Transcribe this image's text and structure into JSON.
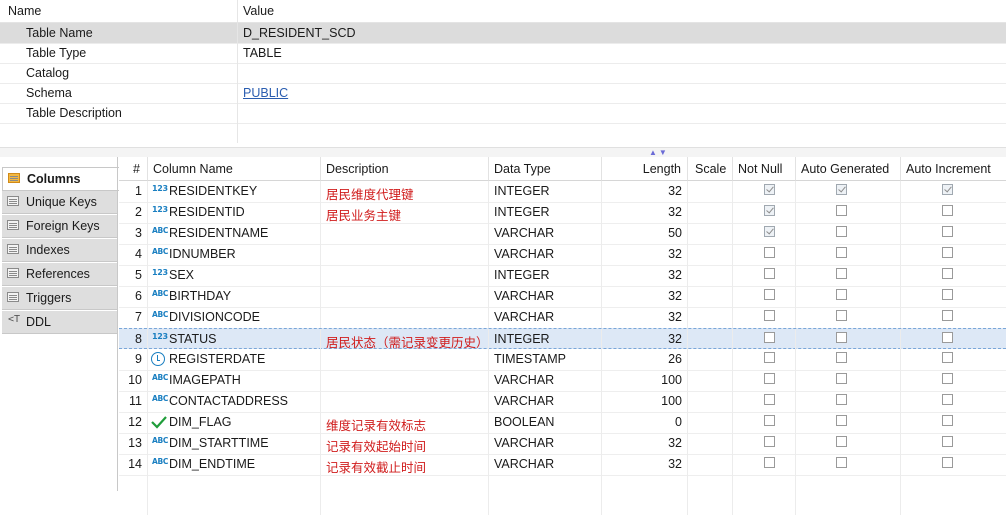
{
  "properties": {
    "header": {
      "name": "Name",
      "value": "Value"
    },
    "rows": [
      {
        "key": "Table Name",
        "value": "D_RESIDENT_SCD"
      },
      {
        "key": "Table Type",
        "value": "TABLE"
      },
      {
        "key": "Catalog",
        "value": ""
      },
      {
        "key": "Schema",
        "value": "PUBLIC"
      },
      {
        "key": "Table Description",
        "value": ""
      }
    ]
  },
  "tabs": [
    {
      "label": "Columns",
      "active": true
    },
    {
      "label": "Unique Keys"
    },
    {
      "label": "Foreign Keys"
    },
    {
      "label": "Indexes"
    },
    {
      "label": "References"
    },
    {
      "label": "Triggers"
    },
    {
      "label": "DDL"
    }
  ],
  "grid": {
    "headers": {
      "num": "#",
      "name": "Column Name",
      "desc": "Description",
      "type": "Data Type",
      "length": "Length",
      "scale": "Scale",
      "notnull": "Not Null",
      "autogen": "Auto Generated",
      "autoinc": "Auto Increment"
    },
    "rows": [
      {
        "n": "1",
        "icon": "123",
        "name": "RESIDENTKEY",
        "desc": "居民维度代理键",
        "type": "INTEGER",
        "length": "32",
        "nn": true,
        "ag": true,
        "ai": true
      },
      {
        "n": "2",
        "icon": "123",
        "name": "RESIDENTID",
        "desc": "居民业务主键",
        "type": "INTEGER",
        "length": "32",
        "nn": true,
        "ag": false,
        "ai": false
      },
      {
        "n": "3",
        "icon": "abc",
        "name": "RESIDENTNAME",
        "desc": "",
        "type": "VARCHAR",
        "length": "50",
        "nn": true,
        "ag": false,
        "ai": false
      },
      {
        "n": "4",
        "icon": "abc",
        "name": "IDNUMBER",
        "desc": "",
        "type": "VARCHAR",
        "length": "32",
        "nn": false,
        "ag": false,
        "ai": false
      },
      {
        "n": "5",
        "icon": "123",
        "name": "SEX",
        "desc": "",
        "type": "INTEGER",
        "length": "32",
        "nn": false,
        "ag": false,
        "ai": false
      },
      {
        "n": "6",
        "icon": "abc",
        "name": "BIRTHDAY",
        "desc": "",
        "type": "VARCHAR",
        "length": "32",
        "nn": false,
        "ag": false,
        "ai": false
      },
      {
        "n": "7",
        "icon": "abc",
        "name": "DIVISIONCODE",
        "desc": "",
        "type": "VARCHAR",
        "length": "32",
        "nn": false,
        "ag": false,
        "ai": false
      },
      {
        "n": "8",
        "icon": "123",
        "name": "STATUS",
        "desc": "居民状态（需记录变更历史）",
        "type": "INTEGER",
        "length": "32",
        "nn": false,
        "ag": false,
        "ai": false,
        "selected": true
      },
      {
        "n": "9",
        "icon": "clock",
        "name": "REGISTERDATE",
        "desc": "",
        "type": "TIMESTAMP",
        "length": "26",
        "nn": false,
        "ag": false,
        "ai": false
      },
      {
        "n": "10",
        "icon": "abc",
        "name": "IMAGEPATH",
        "desc": "",
        "type": "VARCHAR",
        "length": "100",
        "nn": false,
        "ag": false,
        "ai": false
      },
      {
        "n": "11",
        "icon": "abc",
        "name": "CONTACTADDRESS",
        "desc": "",
        "type": "VARCHAR",
        "length": "100",
        "nn": false,
        "ag": false,
        "ai": false
      },
      {
        "n": "12",
        "icon": "check",
        "name": "DIM_FLAG",
        "desc": "维度记录有效标志",
        "type": "BOOLEAN",
        "length": "0",
        "nn": false,
        "ag": false,
        "ai": false
      },
      {
        "n": "13",
        "icon": "abc",
        "name": "DIM_STARTTIME",
        "desc": "记录有效起始时间",
        "type": "VARCHAR",
        "length": "32",
        "nn": false,
        "ag": false,
        "ai": false
      },
      {
        "n": "14",
        "icon": "abc",
        "name": "DIM_ENDTIME",
        "desc": "记录有效截止时间",
        "type": "VARCHAR",
        "length": "32",
        "nn": false,
        "ag": false,
        "ai": false
      }
    ]
  }
}
